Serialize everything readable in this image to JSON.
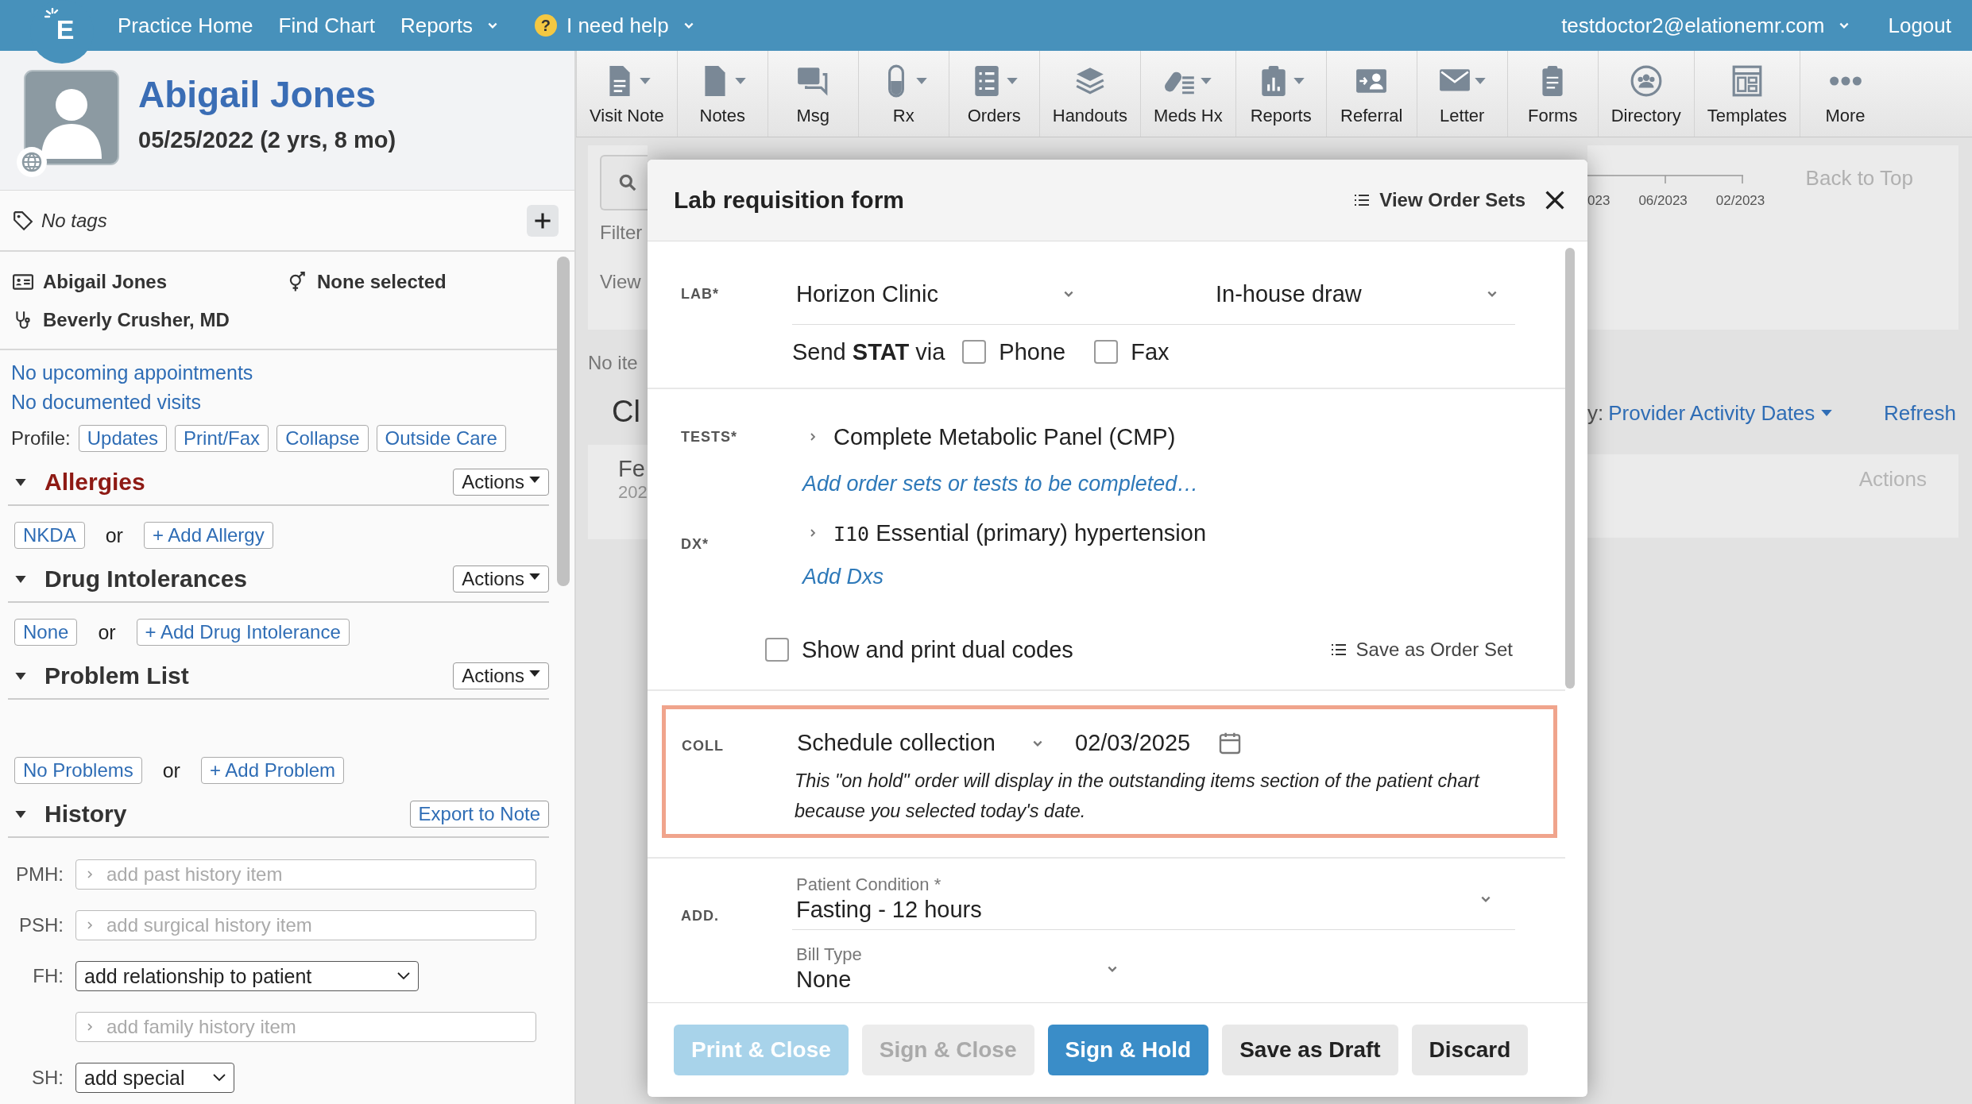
{
  "top_nav": {
    "logo": "E",
    "items": [
      {
        "label": "Practice Home",
        "kind": "link",
        "has_menu": false
      },
      {
        "label": "Find Chart",
        "kind": "link",
        "has_menu": false
      },
      {
        "label": "Reports",
        "kind": "link",
        "has_menu": true
      },
      {
        "label": "I need help",
        "kind": "help",
        "glyph": "?",
        "has_menu": true
      }
    ],
    "user": "testdoctor2@elationemr.com",
    "logout": "Logout"
  },
  "patient": {
    "name": "Abigail Jones",
    "dob": "05/25/2022 (2 yrs, 8 mo)",
    "tags": "No tags",
    "display_name": "Abigail Jones",
    "gender": "None selected",
    "provider": "Beverly Crusher, MD",
    "appointments": "No upcoming appointments",
    "visits": "No documented visits"
  },
  "profile": {
    "label": "Profile:",
    "buttons": [
      "Updates",
      "Print/Fax",
      "Collapse",
      "Outside Care"
    ]
  },
  "sections": [
    {
      "title": "Allergies",
      "alert": true,
      "expanded": true,
      "action": {
        "label": "Actions",
        "has_menu": true
      },
      "options": [
        "NKDA",
        "+ Add Allergy"
      ],
      "or": "or"
    },
    {
      "title": "Drug Intolerances",
      "alert": false,
      "expanded": true,
      "action": {
        "label": "Actions",
        "has_menu": true
      },
      "options": [
        "None",
        "+ Add Drug Intolerance"
      ],
      "or": "or"
    },
    {
      "title": "Problem List",
      "alert": false,
      "expanded": true,
      "action": {
        "label": "Actions",
        "has_menu": true
      },
      "options": [
        "No Problems",
        "+ Add Problem"
      ],
      "or": "or"
    },
    {
      "title": "History",
      "alert": false,
      "expanded": true,
      "action": {
        "label": "Export to Note",
        "has_menu": false
      }
    }
  ],
  "history": [
    {
      "label": "PMH:",
      "kind": "input",
      "placeholder": "add past history item"
    },
    {
      "label": "PSH:",
      "kind": "input",
      "placeholder": "add surgical history item"
    },
    {
      "label": "FH:",
      "kind": "select",
      "value": "add relationship to patient"
    },
    {
      "kind": "input",
      "placeholder": "add family history item"
    },
    {
      "label": "SH:",
      "kind": "select",
      "value": "add special"
    }
  ],
  "toolbar": [
    {
      "label": "Visit Note",
      "has_menu": true
    },
    {
      "label": "Notes",
      "has_menu": true
    },
    {
      "label": "Msg",
      "has_menu": false
    },
    {
      "label": "Rx",
      "has_menu": true
    },
    {
      "label": "Orders",
      "has_menu": true
    },
    {
      "label": "Handouts",
      "has_menu": false
    },
    {
      "label": "Meds Hx",
      "has_menu": true
    },
    {
      "label": "Reports",
      "has_menu": true
    },
    {
      "label": "Referral",
      "has_menu": false
    },
    {
      "label": "Letter",
      "has_menu": true
    },
    {
      "label": "Forms",
      "has_menu": false
    },
    {
      "label": "Directory",
      "has_menu": false
    },
    {
      "label": "Templates",
      "has_menu": false
    },
    {
      "label": "More",
      "has_menu": false
    }
  ],
  "background": {
    "filter": "Filter",
    "view": "View",
    "empty_text": "No ite",
    "heading": "Cl",
    "card_title": "Fe",
    "card_date": "202",
    "timeline": [
      "023",
      "06/2023",
      "02/2023"
    ],
    "back_to_top": "Back to Top",
    "sort_label": "y:",
    "sort_value": "Provider Activity Dates",
    "refresh": "Refresh",
    "card_actions": "Actions"
  },
  "modal": {
    "title": "Lab requisition form",
    "view_order_sets": "View Order Sets",
    "lab": {
      "label": "LAB*",
      "lab_name": "Horizon Clinic",
      "draw": "In-house draw",
      "stat_text": "Send **STAT** via",
      "stat_options": [
        {
          "label": "Phone",
          "checked": false
        },
        {
          "label": "Fax",
          "checked": false
        }
      ]
    },
    "tests": {
      "label": "TESTS*",
      "items": [
        "Complete Metabolic Panel (CMP)"
      ],
      "add_link": "Add order sets or tests to be completed…"
    },
    "dx": {
      "label": "DX*",
      "items": [
        {
          "code": "I10",
          "description": "Essential (primary) hypertension"
        }
      ],
      "add_link": "Add Dxs",
      "dual_codes": {
        "label": "Show and print dual codes",
        "checked": false
      },
      "save_order_set": "Save as Order Set"
    },
    "collection": {
      "label": "COLL",
      "highlighted": true,
      "method": "Schedule collection",
      "date": "02/03/2025",
      "note": "This \"on hold\" order will display in the outstanding items section of the patient chart because you selected today's date."
    },
    "additional": {
      "label": "ADD.",
      "fields": [
        {
          "label": "Patient Condition *",
          "value": "Fasting - 12 hours"
        },
        {
          "label": "Bill Type",
          "value": "None"
        }
      ]
    },
    "buttons": [
      {
        "label": "Print & Close",
        "primary": true,
        "disabled": true
      },
      {
        "label": "Sign & Close",
        "primary": false,
        "disabled": true
      },
      {
        "label": "Sign & Hold",
        "primary": true,
        "disabled": false
      },
      {
        "label": "Save as Draft",
        "primary": false,
        "disabled": false
      },
      {
        "label": "Discard",
        "primary": false,
        "disabled": false
      }
    ]
  }
}
